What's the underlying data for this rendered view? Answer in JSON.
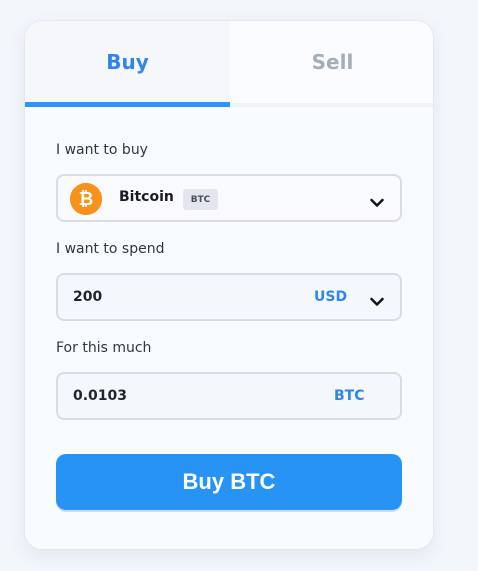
{
  "tabs": {
    "buy": "Buy",
    "sell": "Sell"
  },
  "buy_form": {
    "asset_label": "I want to buy",
    "asset": {
      "name": "Bitcoin",
      "symbol": "BTC",
      "icon": "bitcoin-icon",
      "icon_color": "#f7931a"
    },
    "spend_label": "I want to spend",
    "spend": {
      "value": "200",
      "currency": "USD"
    },
    "receive_label": "For this much",
    "receive": {
      "value": "0.0103",
      "currency": "BTC"
    },
    "submit_label": "Buy BTC"
  },
  "colors": {
    "accent": "#2793f5",
    "active_tab_text": "#2f86ea",
    "inactive_tab_text": "#a5adb8"
  }
}
